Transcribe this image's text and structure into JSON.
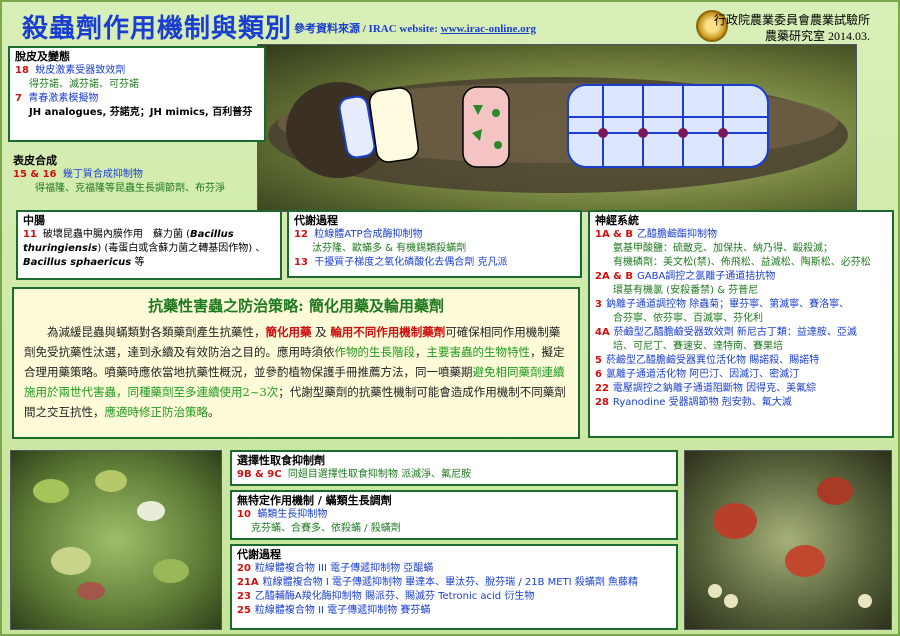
{
  "header": {
    "title": "殺蟲劑作用機制與類別",
    "source_label": "參考資料來源 / IRAC website: ",
    "source_url": "www.irac-online.org",
    "org_line1": "行政院農業委員會農業試驗所",
    "org_line2": "農藥研究室 2014.03."
  },
  "molting": {
    "heading": "脫皮及變態",
    "g18_num": "18",
    "g18_name": "蛻皮激素受器致效劑",
    "g18_items": "得芬諾、滅芬諾、可芬諾",
    "g7_num": "7",
    "g7_name": "青春激素模擬物",
    "g7_items": "JH analogues, 芬諾克；JH mimics, 百利普芬"
  },
  "cuticle": {
    "heading": "表皮合成",
    "num": "15 & 16",
    "name": "幾丁質合成抑制物",
    "items": "得福隆、克福隆等昆蟲生長調節劑、布芬淨"
  },
  "midgut": {
    "heading": "中腸",
    "num": "11",
    "name_a": "破壞昆蟲中腸內膜作用　蘇力菌 (",
    "name_italic": "Bacillus thuringiensis",
    "name_b": ") (毒蛋白或含蘇力菌之轉基因作物) 、",
    "name_italic2": "Bacillus sphaericus",
    "name_c": " 等"
  },
  "metabolism": {
    "heading": "代謝過程",
    "g12_num": "12",
    "g12_name": "粒線體ATP合成酶抑制物",
    "g12_items": "汰芬隆、歐蟎多 & 有機錫類殺蟎劑",
    "g13_num": "13",
    "g13_name": "干擾質子梯度之氧化磷酸化去偶合劑 克凡派"
  },
  "nerve": {
    "heading": "神經系統",
    "rows": [
      {
        "num": "1A & B",
        "text": "乙醯膽鹼酯抑制物"
      },
      {
        "num": "",
        "text": "氨基甲酸鹽：硫敵克、加保扶、納乃得、毆殺滅；"
      },
      {
        "num": "",
        "text": "有機磷劑：美文松(禁)、佈飛松、益滅松、陶斯松、必芬松"
      },
      {
        "num": "2A & B",
        "text": "GABA調控之氯離子通道拮抗物"
      },
      {
        "num": "",
        "text": "環基有機氯 (安殺番禁) & 芬普尼"
      },
      {
        "num": "3",
        "text": "鈉離子通道調控物 除蟲菊；畢芬寧、第滅寧、賽洛寧、"
      },
      {
        "num": "",
        "text": "合芬寧、依芬寧、百滅寧、芬化利"
      },
      {
        "num": "4A",
        "text": "菸鹼型乙醯膽鹼受器致效劑 新尼古丁類：益達胺、亞滅"
      },
      {
        "num": "",
        "text": "培、可尼丁、賽速安、達特南、賽果培"
      },
      {
        "num": "5",
        "text": "菸鹼型乙醯膽鹼受器異位活化物 賜諾殺、賜諾特"
      },
      {
        "num": "6",
        "text": "氯離子通道活化物 阿巴汀、因滅汀、密滅汀"
      },
      {
        "num": "22",
        "text": "電壓調控之鈉離子通道阻斷物 因得克、美氟綜"
      },
      {
        "num": "28",
        "text": "Ryanodine 受器調節物 剋安勃、氟大滅"
      }
    ]
  },
  "strategy": {
    "title": "抗藥性害蟲之防治策略: 簡化用藥及輪用藥劑",
    "p1": "為減緩昆蟲與蟎類對各類藥劑產生抗藥性，",
    "p1_red1": "簡化用藥",
    "p1_and": " 及 ",
    "p1_red2": "輪用不同作用機制藥劑",
    "p2": "可確保相同作用機制藥劑免受抗藥性汰選，達到永續及有效防治之目的。應用時須依",
    "p2_hl1": "作物的生長階段",
    "p2_sep": "，",
    "p2_hl2": "主要害蟲的生物特性",
    "p3": "，擬定合理用藥策略。噴藥時應依當地抗藥性概況，並參酌植物保護手冊推薦方法，同一噴藥期",
    "p3_hl": "避免相同藥劑連續施用於兩世代害蟲，同種藥劑至多連續使用2~3次",
    "p4": "；代謝型藥劑的抗藥性機制可能會造成作用機制不同藥劑間之交互抗性，",
    "p4_hl": "應適時修正防治策略",
    "p4_end": "。"
  },
  "feeding": {
    "heading": "選擇性取食抑制劑",
    "num": "9B & 9C",
    "text": "同翅目選擇性取食抑制物 派滅淨、氟尼胺"
  },
  "nonspecific": {
    "heading": "無特定作用機制 / 蟎類生長調劑",
    "num": "10",
    "name": "蟎類生長抑制物",
    "items": "克芬蟎、合賽多、依殺蟎 / 殺蟎劑"
  },
  "metabolism2": {
    "heading": "代謝過程",
    "rows": [
      {
        "num": "20",
        "text": "粒線體複合物 III 電子傳遞抑制物 亞醌蟎"
      },
      {
        "num": "21A",
        "text": "粒線體複合物 I 電子傳遞抑制物 畢達本、畢汰芬、脫芬瑞 / 21B METI 殺蟎劑 魚藤精"
      },
      {
        "num": "23",
        "text": "乙醯輔酶A羧化酶抑制物 賜派芬、賜滅芬 Tetronic acid 衍生物"
      },
      {
        "num": "25",
        "text": "粒線體複合物 II 電子傳遞抑制物 賽芬蟎"
      }
    ]
  },
  "colors": {
    "title_blue": "#1a3fd0",
    "group_red": "#d01010",
    "text_green": "#1f7a1f",
    "border_green": "#1c6b2e"
  }
}
